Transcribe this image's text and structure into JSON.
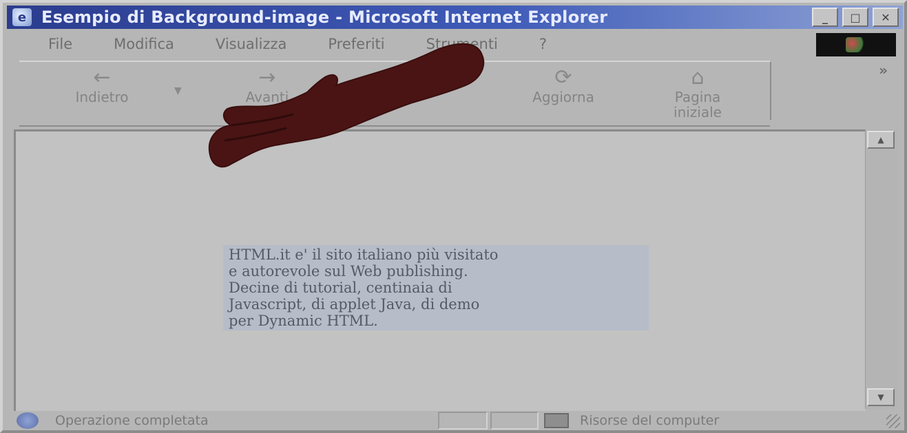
{
  "window": {
    "title": "Esempio di Background-image - Microsoft Internet Explorer"
  },
  "menu": {
    "items": [
      "File",
      "Modifica",
      "Visualizza",
      "Preferiti",
      "Strumenti",
      "?"
    ]
  },
  "toolbar": {
    "back_label": "Indietro",
    "forward_label": "Avanti",
    "refresh_label": "Aggiorna",
    "home_label_line1": "Pagina",
    "home_label_line2": "iniziale"
  },
  "content": {
    "text_lines": [
      "HTML.it e' il sito italiano più visitato",
      "e autorevole sul Web publishing.",
      "Decine di tutorial, centinaia di",
      "Javascript, di applet Java, di demo",
      "per Dynamic HTML."
    ]
  },
  "status": {
    "message": "Operazione completata",
    "zone": "Risorse del computer"
  },
  "colors": {
    "titlebar_start": "#2b3c8e",
    "titlebar_end": "#8fa3d6",
    "hand": "#4a1414",
    "textbox_bg": "#b6bcc8"
  }
}
